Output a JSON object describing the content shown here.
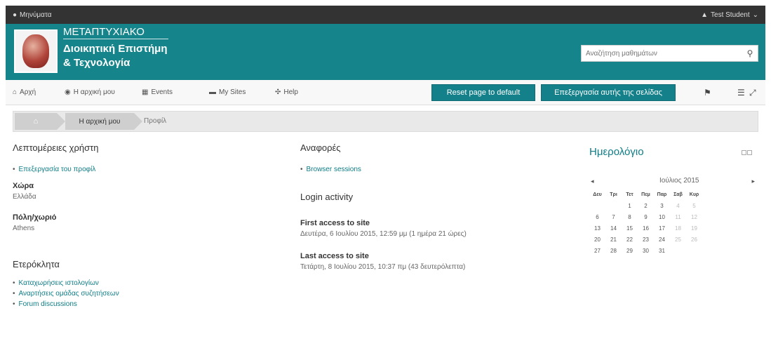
{
  "topbar": {
    "messages": "Μηνύματα",
    "user": "Test Student"
  },
  "header": {
    "top_line": "ΜΕΤΑΠΤΥΧΙΑΚΟ",
    "title_line1": "Διοικητική Επιστήμη",
    "title_line2": "& Τεχνολογία",
    "search_placeholder": "Αναζήτηση μαθημάτων"
  },
  "nav": {
    "home": "Αρχή",
    "my_home": "Η αρχική μου",
    "events": "Events",
    "my_sites": "My Sites",
    "help": "Help",
    "reset_button": "Reset page to default",
    "edit_button": "Επεξεργασία αυτής της σελίδας"
  },
  "breadcrumb": {
    "current": "Η αρχική μου",
    "last": "Προφίλ"
  },
  "user_details": {
    "title": "Λεπτομέρειες χρήστη",
    "edit_link": "Επεξεργασία του προφίλ",
    "country_label": "Χώρα",
    "country_value": "Ελλάδα",
    "city_label": "Πόλη/χωριό",
    "city_value": "Athens"
  },
  "misc": {
    "title": "Ετερόκλητα",
    "links": [
      "Καταχωρήσεις ιστολογίων",
      "Αναρτήσεις ομάδας συζητήσεων",
      "Forum discussions"
    ]
  },
  "reports": {
    "title": "Αναφορές",
    "link": "Browser sessions"
  },
  "login": {
    "title": "Login activity",
    "first_label": "First access to site",
    "first_value": "Δευτέρα, 6 Ιουλίου 2015, 12:59 μμ  (1 ημέρα 21 ώρες)",
    "last_label": "Last access to site",
    "last_value": "Τετάρτη, 8 Ιουλίου 2015, 10:37 πμ  (43 δευτερόλεπτα)"
  },
  "calendar": {
    "title": "Ημερολόγιο",
    "month": "Ιούλιος 2015",
    "prev": "◂",
    "next": "▸",
    "weekdays": [
      "Δευ",
      "Τρι",
      "Τετ",
      "Πεμ",
      "Παρ",
      "Σαβ",
      "Κυρ"
    ],
    "weeks": [
      [
        "",
        "",
        "1",
        "2",
        "3",
        "4",
        "5"
      ],
      [
        "6",
        "7",
        "8",
        "9",
        "10",
        "11",
        "12"
      ],
      [
        "13",
        "14",
        "15",
        "16",
        "17",
        "18",
        "19"
      ],
      [
        "20",
        "21",
        "22",
        "23",
        "24",
        "25",
        "26"
      ],
      [
        "27",
        "28",
        "29",
        "30",
        "31",
        "",
        ""
      ]
    ]
  }
}
